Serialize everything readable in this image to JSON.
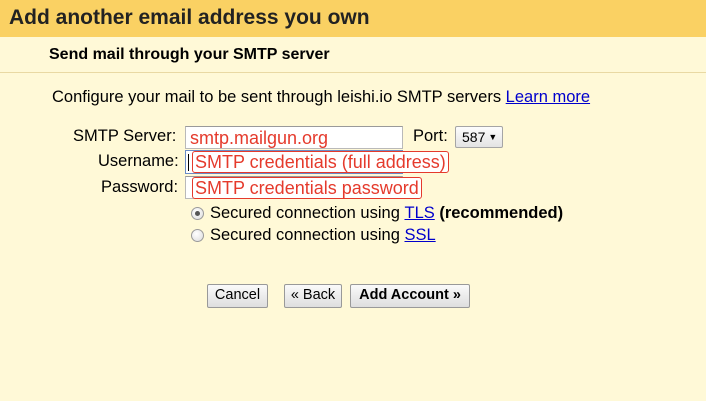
{
  "dialog": {
    "title": "Add another email address you own",
    "subtitle": "Send mail through your SMTP server"
  },
  "description": {
    "text": "Configure your mail to be sent through leishi.io SMTP servers",
    "learn_more": "Learn more"
  },
  "form": {
    "smtp_server_label": "SMTP Server:",
    "smtp_server_value": "smtp.mailgun.org",
    "port_label": "Port:",
    "port_value": "587",
    "username_label": "Username:",
    "username_value": "SMTP credentials (full address)",
    "password_label": "Password:",
    "password_value": "SMTP credentials password"
  },
  "security": {
    "tls_prefix": "Secured connection using",
    "tls_link": "TLS",
    "tls_suffix": "(recommended)",
    "ssl_prefix": "Secured connection using",
    "ssl_link": "SSL",
    "selected": "TLS"
  },
  "buttons": {
    "cancel": "Cancel",
    "back": "« Back",
    "add_account": "Add Account »"
  },
  "colors": {
    "title_bar": "#fad163",
    "background": "#fff9d7",
    "annotation_red": "#e53a2c",
    "link": "#0000cc"
  }
}
